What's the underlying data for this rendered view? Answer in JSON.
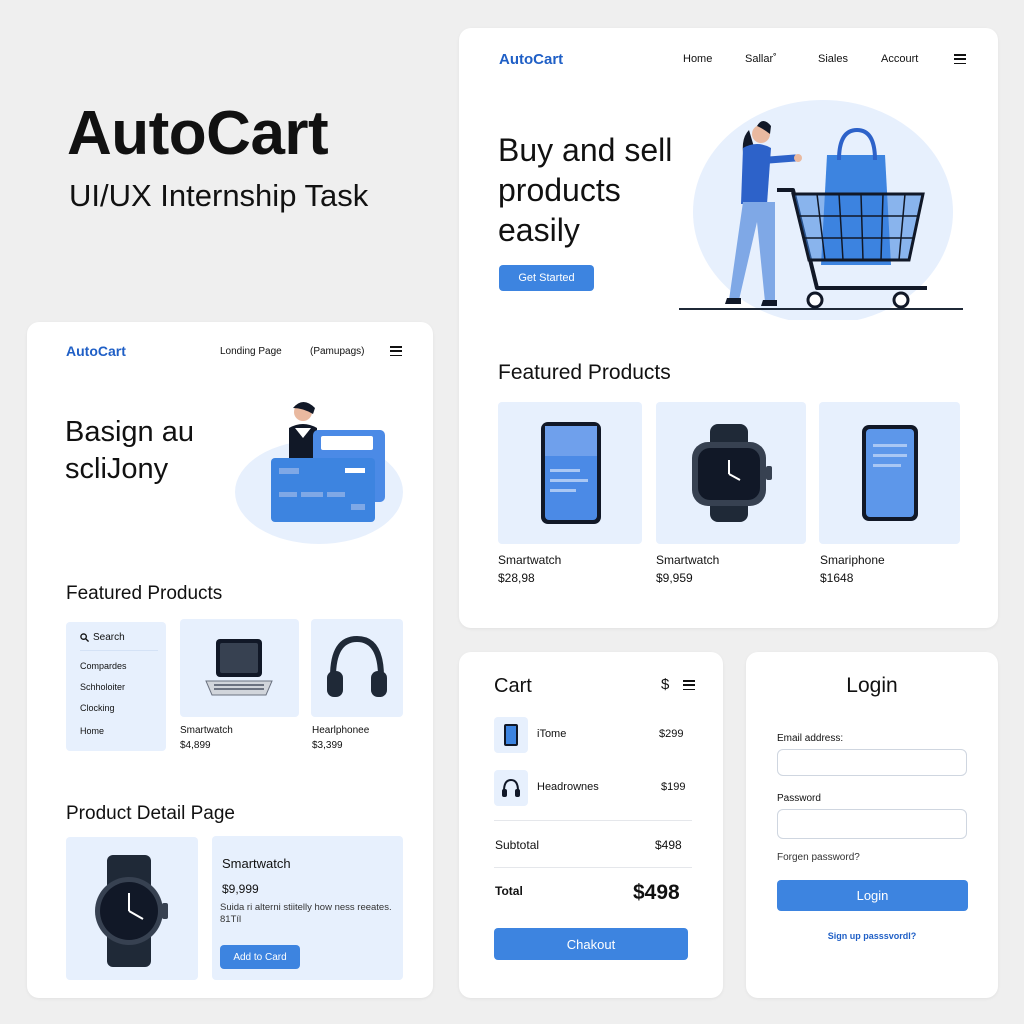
{
  "title": {
    "main": "AutoCart",
    "sub": "UI/UX Internship Task"
  },
  "colors": {
    "accent": "#3d84e0",
    "brand": "#1f5fc6",
    "tile": "#e7f0fd"
  },
  "landing": {
    "brand": "AutoCart",
    "nav": [
      "Home",
      "Sallar˚",
      "Siales",
      "Accourt"
    ],
    "menu_icon": "hamburger-icon",
    "hero_lines": [
      "Buy and sell",
      "products",
      "easily"
    ],
    "cta": "Get Started",
    "featured_title": "Featured Products",
    "products": [
      {
        "name": "Smartwatch",
        "price": "$28,98",
        "icon": "smartphone-icon"
      },
      {
        "name": "Smartwatch",
        "price": "$9,959",
        "icon": "smartwatch-icon"
      },
      {
        "name": "Smariphone",
        "price": "$1648",
        "icon": "smartphone-icon"
      }
    ]
  },
  "mobile": {
    "brand": "AutoCart",
    "nav": [
      "Londing Page",
      "(Pamupags)"
    ],
    "hero_lines": [
      "Basign au",
      "scliJony"
    ],
    "featured_title": "Featured Products",
    "sidebar": {
      "search": "Search",
      "items": [
        "Compardes",
        "Schholoiter",
        "Clocking",
        "Home"
      ]
    },
    "products": [
      {
        "name": "Smartwatch",
        "price": "$4,899",
        "icon": "laptop-icon"
      },
      {
        "name": "Hearlphonee",
        "price": "$3,399",
        "icon": "headphones-icon"
      }
    ],
    "detail_title": "Product Detail Page",
    "detail": {
      "name": "Smartwatch",
      "price": "$9,999",
      "desc_line1": "Suida ri alterni stiitelly how ness reeates.",
      "desc_line2": "81Tíl",
      "button": "Add to Card"
    }
  },
  "cart": {
    "title": "Cart",
    "currency_icon": "$",
    "items": [
      {
        "name": "iTome",
        "price": "$299",
        "icon": "phone-icon"
      },
      {
        "name": "Headrownes",
        "price": "$199",
        "icon": "headphones-icon"
      }
    ],
    "subtotal_label": "Subtotal",
    "subtotal": "$498",
    "total_label": "Total",
    "total": "$498",
    "checkout": "Chakout"
  },
  "login": {
    "title": "Login",
    "email_label": "Email address:",
    "email_value": "",
    "password_label": "Password",
    "password_value": "",
    "forgot": "Forgen password?",
    "button": "Login",
    "signup": "Sign up passsvordl?"
  }
}
